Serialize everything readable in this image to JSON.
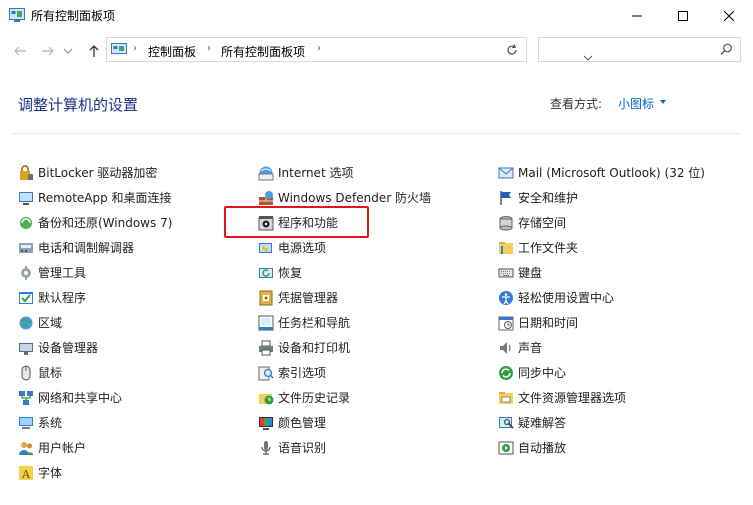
{
  "window": {
    "title": "所有控制面板项"
  },
  "address": {
    "crumbs": [
      "控制面板",
      "所有控制面板项"
    ],
    "search_placeholder": ""
  },
  "header": {
    "title": "调整计算机的设置",
    "view_by_label": "查看方式:",
    "view_by_value": "小图标"
  },
  "columns": [
    [
      {
        "label": "BitLocker 驱动器加密",
        "icon": "bitlocker-icon"
      },
      {
        "label": "RemoteApp 和桌面连接",
        "icon": "remoteapp-icon"
      },
      {
        "label": "备份和还原(Windows 7)",
        "icon": "backup-icon"
      },
      {
        "label": "电话和调制解调器",
        "icon": "phone-modem-icon"
      },
      {
        "label": "管理工具",
        "icon": "admin-tools-icon"
      },
      {
        "label": "默认程序",
        "icon": "default-programs-icon"
      },
      {
        "label": "区域",
        "icon": "region-icon"
      },
      {
        "label": "设备管理器",
        "icon": "device-manager-icon"
      },
      {
        "label": "鼠标",
        "icon": "mouse-icon"
      },
      {
        "label": "网络和共享中心",
        "icon": "network-icon"
      },
      {
        "label": "系统",
        "icon": "system-icon"
      },
      {
        "label": "用户帐户",
        "icon": "user-accounts-icon"
      },
      {
        "label": "字体",
        "icon": "fonts-icon"
      }
    ],
    [
      {
        "label": "Internet 选项",
        "icon": "internet-options-icon"
      },
      {
        "label": "Windows Defender 防火墙",
        "icon": "firewall-icon"
      },
      {
        "label": "程序和功能",
        "icon": "programs-features-icon"
      },
      {
        "label": "电源选项",
        "icon": "power-icon"
      },
      {
        "label": "恢复",
        "icon": "recovery-icon"
      },
      {
        "label": "凭据管理器",
        "icon": "credential-manager-icon"
      },
      {
        "label": "任务栏和导航",
        "icon": "taskbar-icon"
      },
      {
        "label": "设备和打印机",
        "icon": "printer-icon"
      },
      {
        "label": "索引选项",
        "icon": "indexing-icon"
      },
      {
        "label": "文件历史记录",
        "icon": "file-history-icon"
      },
      {
        "label": "颜色管理",
        "icon": "color-management-icon"
      },
      {
        "label": "语音识别",
        "icon": "speech-icon"
      }
    ],
    [
      {
        "label": "Mail (Microsoft Outlook) (32 位)",
        "icon": "mail-icon"
      },
      {
        "label": "安全和维护",
        "icon": "security-flag-icon"
      },
      {
        "label": "存储空间",
        "icon": "storage-icon"
      },
      {
        "label": "工作文件夹",
        "icon": "work-folders-icon"
      },
      {
        "label": "键盘",
        "icon": "keyboard-icon"
      },
      {
        "label": "轻松使用设置中心",
        "icon": "ease-of-access-icon"
      },
      {
        "label": "日期和时间",
        "icon": "date-time-icon"
      },
      {
        "label": "声音",
        "icon": "sound-icon"
      },
      {
        "label": "同步中心",
        "icon": "sync-icon"
      },
      {
        "label": "文件资源管理器选项",
        "icon": "explorer-options-icon"
      },
      {
        "label": "疑难解答",
        "icon": "troubleshooting-icon"
      },
      {
        "label": "自动播放",
        "icon": "autoplay-icon"
      }
    ]
  ],
  "colors": {
    "title_blue": "#1e3287",
    "link_blue": "#0066cc",
    "highlight_red": "#e0161d"
  }
}
